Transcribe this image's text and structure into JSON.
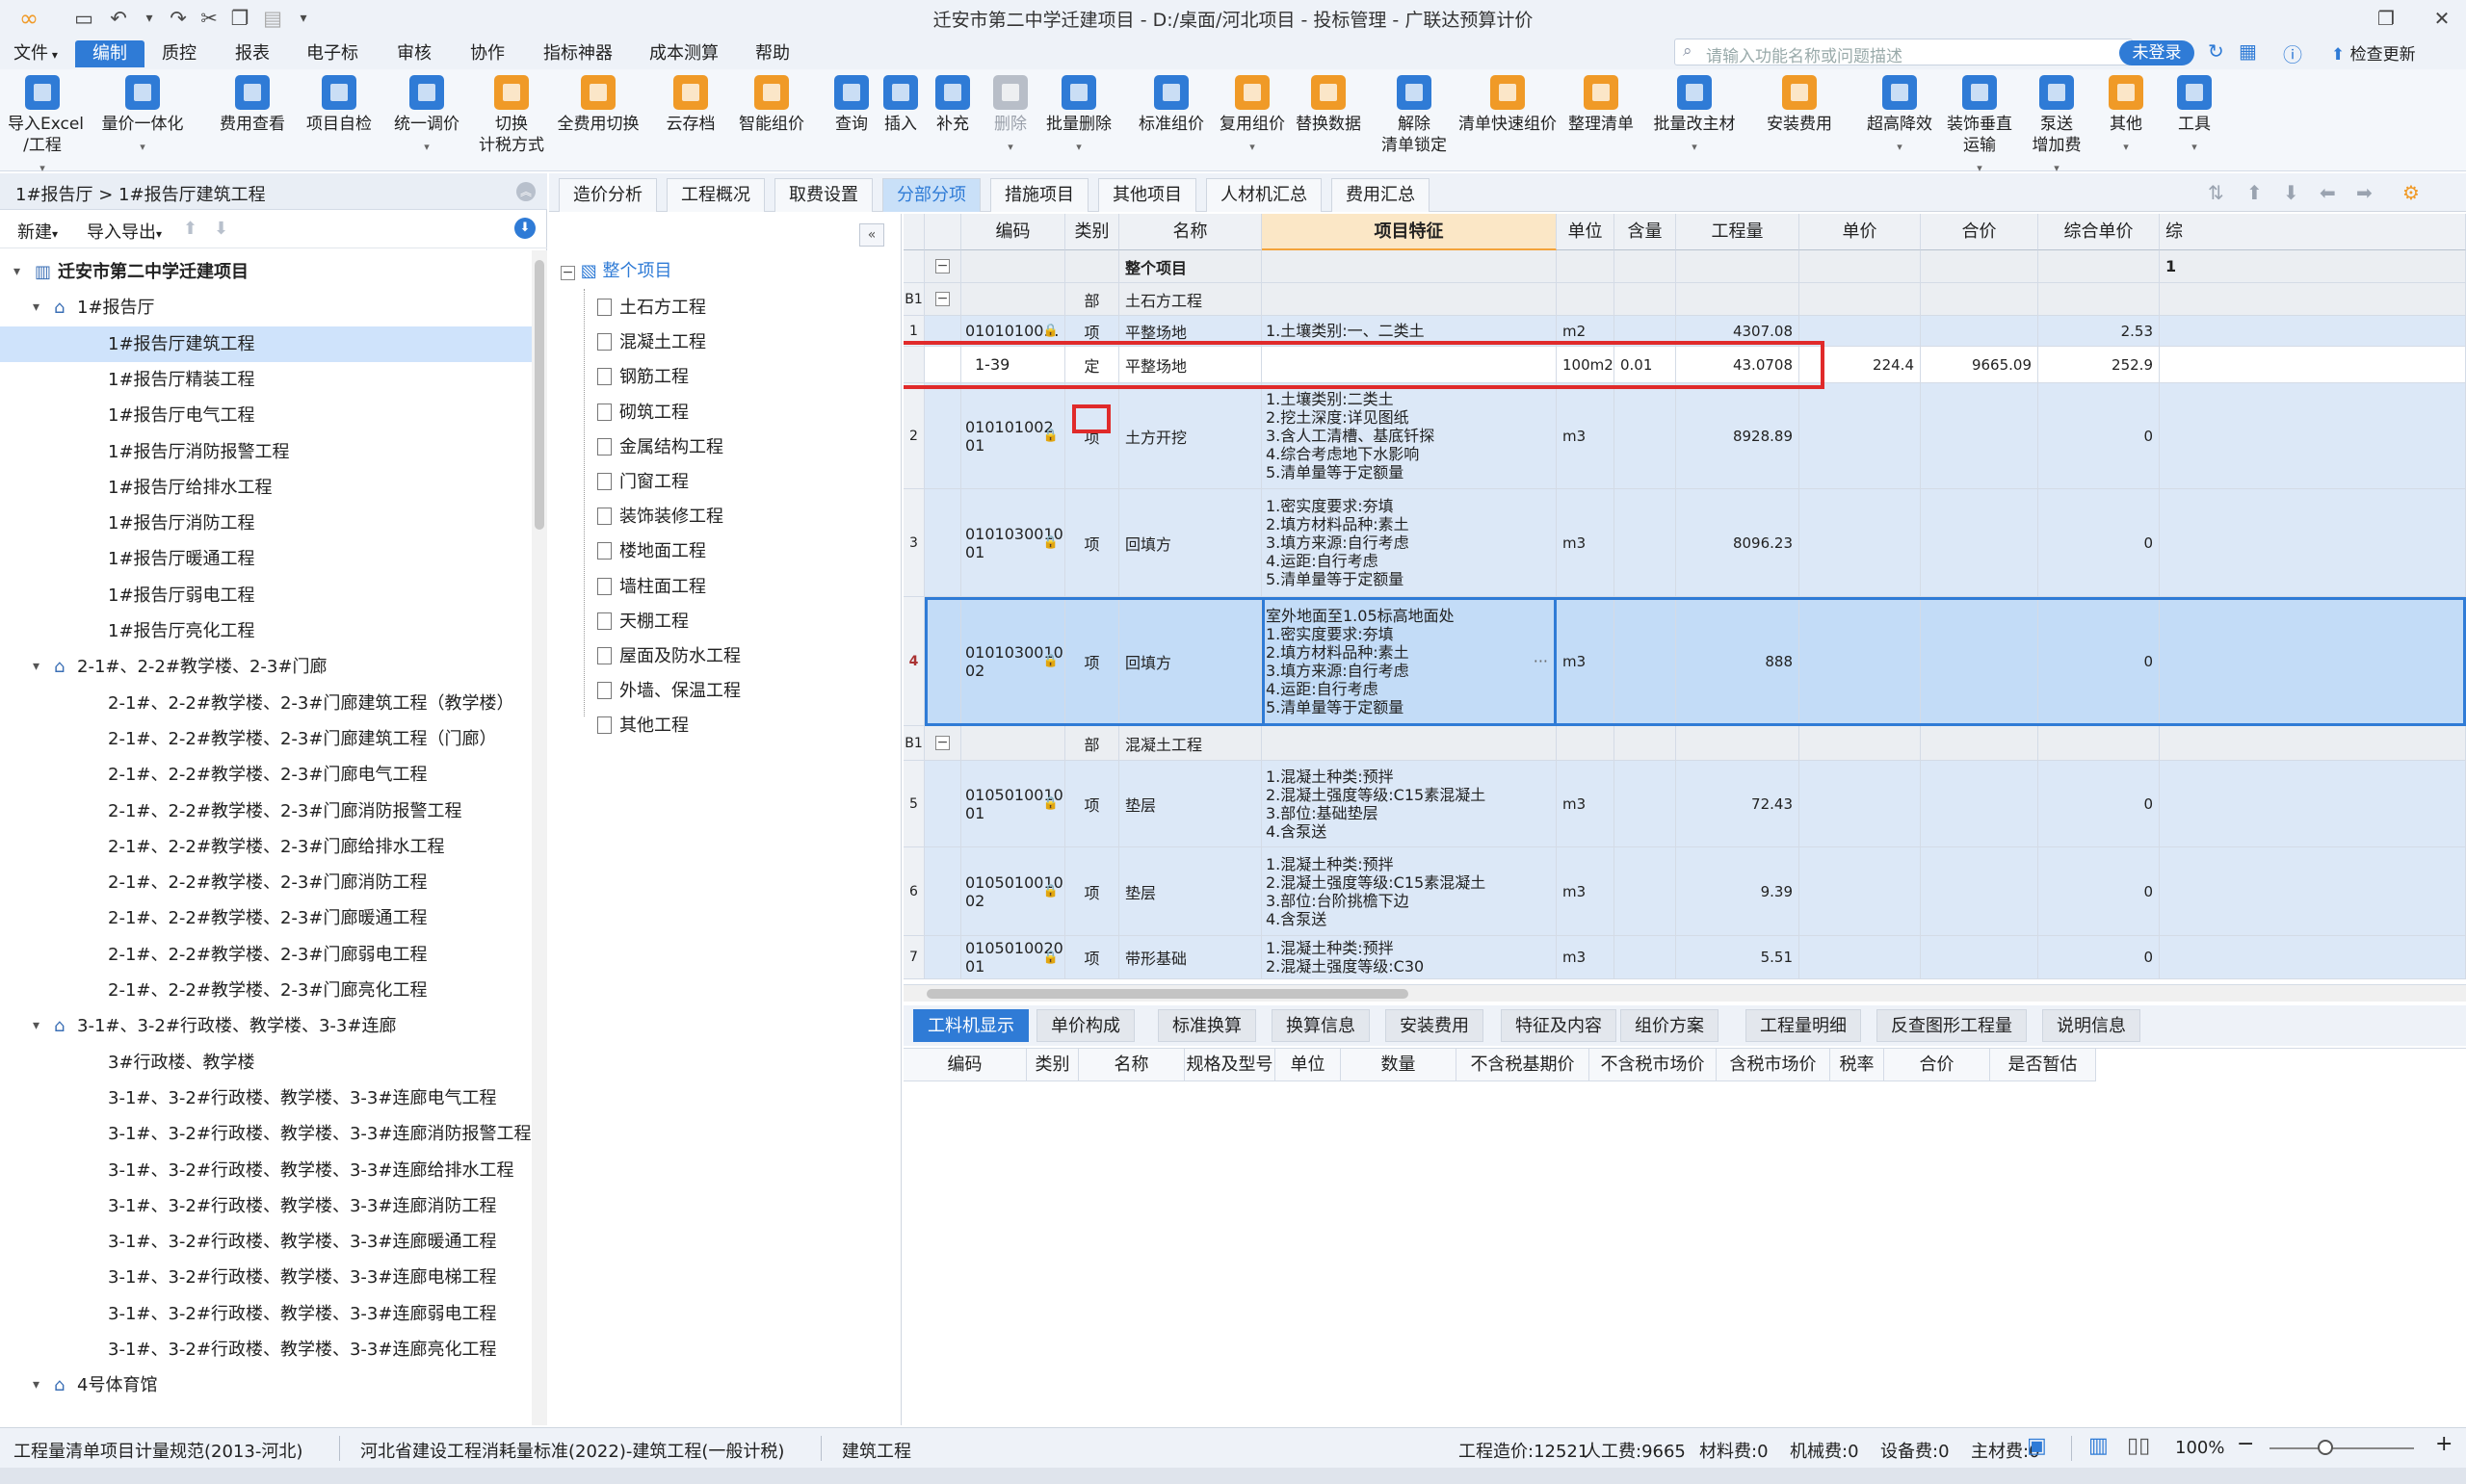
{
  "window": {
    "title": "迁安市第二中学迁建项目 - D:/桌面/河北项目 - 投标管理 - 广联达预算计价",
    "controls": {
      "restore": "❐",
      "close": "✕"
    }
  },
  "menus": [
    "文件",
    "编制",
    "质控",
    "报表",
    "电子标",
    "审核",
    "协作",
    "指标神器",
    "成本测算",
    "帮助"
  ],
  "active_menu": "编制",
  "search": {
    "placeholder": "请输入功能名称或问题描述"
  },
  "login_label": "未登录",
  "update_label": "检查更新",
  "ribbon": [
    {
      "label": "导入Excel\n/工程",
      "icon": "import-excel-icon",
      "color": "blue"
    },
    {
      "label": "量价一体化",
      "icon": "integration-icon",
      "color": "blue"
    },
    {
      "label": "费用查看",
      "icon": "fee-view-icon",
      "color": "blue"
    },
    {
      "label": "项目自检",
      "icon": "self-check-icon",
      "color": "blue"
    },
    {
      "label": "统一调价",
      "icon": "price-adjust-icon",
      "color": "blue"
    },
    {
      "label": "切换\n计税方式",
      "icon": "tax-switch-icon",
      "color": "orange"
    },
    {
      "label": "全费用切换",
      "icon": "full-cost-icon",
      "color": "orange"
    },
    {
      "label": "云存档",
      "icon": "cloud-save-icon",
      "color": "orange"
    },
    {
      "label": "智能组价",
      "icon": "smart-price-icon",
      "color": "orange"
    },
    {
      "label": "查询",
      "icon": "query-icon",
      "color": "blue"
    },
    {
      "label": "插入",
      "icon": "insert-icon",
      "color": "blue"
    },
    {
      "label": "补充",
      "icon": "supplement-icon",
      "color": "blue"
    },
    {
      "label": "删除",
      "icon": "delete-icon",
      "color": "gray"
    },
    {
      "label": "批量删除",
      "icon": "batch-delete-icon",
      "color": "blue"
    },
    {
      "label": "标准组价",
      "icon": "standard-price-icon",
      "color": "blue"
    },
    {
      "label": "复用组价",
      "icon": "reuse-price-icon",
      "color": "orange"
    },
    {
      "label": "替换数据",
      "icon": "replace-data-icon",
      "color": "orange"
    },
    {
      "label": "解除\n清单锁定",
      "icon": "unlock-icon",
      "color": "blue"
    },
    {
      "label": "清单快速组价",
      "icon": "quick-price-icon",
      "color": "orange"
    },
    {
      "label": "整理清单",
      "icon": "organize-icon",
      "color": "orange"
    },
    {
      "label": "批量改主材",
      "icon": "batch-material-icon",
      "color": "blue"
    },
    {
      "label": "安装费用",
      "icon": "install-fee-icon",
      "color": "orange"
    },
    {
      "label": "超高降效",
      "icon": "height-efficiency-icon",
      "color": "blue"
    },
    {
      "label": "装饰垂直\n运输",
      "icon": "vertical-transport-icon",
      "color": "blue"
    },
    {
      "label": "泵送\n增加费",
      "icon": "pump-fee-icon",
      "color": "blue"
    },
    {
      "label": "其他",
      "icon": "other-icon",
      "color": "orange"
    },
    {
      "label": "工具",
      "icon": "tools-icon",
      "color": "blue"
    }
  ],
  "left": {
    "breadcrumb": "1#报告厅 > 1#报告厅建筑工程",
    "new_label": "新建",
    "io_label": "导入导出",
    "tree": [
      {
        "label": "迁安市第二中学迁建项目",
        "level": 0,
        "type": "project",
        "expanded": true
      },
      {
        "label": "1#报告厅",
        "level": 1,
        "type": "unit",
        "expanded": true
      },
      {
        "label": "1#报告厅建筑工程",
        "level": 2,
        "selected": true
      },
      {
        "label": "1#报告厅精装工程",
        "level": 2
      },
      {
        "label": "1#报告厅电气工程",
        "level": 2
      },
      {
        "label": "1#报告厅消防报警工程",
        "level": 2
      },
      {
        "label": "1#报告厅给排水工程",
        "level": 2
      },
      {
        "label": "1#报告厅消防工程",
        "level": 2
      },
      {
        "label": "1#报告厅暖通工程",
        "level": 2
      },
      {
        "label": "1#报告厅弱电工程",
        "level": 2
      },
      {
        "label": "1#报告厅亮化工程",
        "level": 2
      },
      {
        "label": "2-1#、2-2#教学楼、2-3#门廊",
        "level": 1,
        "type": "unit",
        "expanded": true
      },
      {
        "label": "2-1#、2-2#教学楼、2-3#门廊建筑工程（教学楼）",
        "level": 2
      },
      {
        "label": "2-1#、2-2#教学楼、2-3#门廊建筑工程（门廊）",
        "level": 2
      },
      {
        "label": "2-1#、2-2#教学楼、2-3#门廊电气工程",
        "level": 2
      },
      {
        "label": "2-1#、2-2#教学楼、2-3#门廊消防报警工程",
        "level": 2
      },
      {
        "label": "2-1#、2-2#教学楼、2-3#门廊给排水工程",
        "level": 2
      },
      {
        "label": "2-1#、2-2#教学楼、2-3#门廊消防工程",
        "level": 2
      },
      {
        "label": "2-1#、2-2#教学楼、2-3#门廊暖通工程",
        "level": 2
      },
      {
        "label": "2-1#、2-2#教学楼、2-3#门廊弱电工程",
        "level": 2
      },
      {
        "label": "2-1#、2-2#教学楼、2-3#门廊亮化工程",
        "level": 2
      },
      {
        "label": "3-1#、3-2#行政楼、教学楼、3-3#连廊",
        "level": 1,
        "type": "unit",
        "expanded": true
      },
      {
        "label": "3#行政楼、教学楼",
        "level": 2
      },
      {
        "label": "3-1#、3-2#行政楼、教学楼、3-3#连廊电气工程",
        "level": 2
      },
      {
        "label": "3-1#、3-2#行政楼、教学楼、3-3#连廊消防报警工程",
        "level": 2
      },
      {
        "label": "3-1#、3-2#行政楼、教学楼、3-3#连廊给排水工程",
        "level": 2
      },
      {
        "label": "3-1#、3-2#行政楼、教学楼、3-3#连廊消防工程",
        "level": 2
      },
      {
        "label": "3-1#、3-2#行政楼、教学楼、3-3#连廊暖通工程",
        "level": 2
      },
      {
        "label": "3-1#、3-2#行政楼、教学楼、3-3#连廊电梯工程",
        "level": 2
      },
      {
        "label": "3-1#、3-2#行政楼、教学楼、3-3#连廊弱电工程",
        "level": 2
      },
      {
        "label": "3-1#、3-2#行政楼、教学楼、3-3#连廊亮化工程",
        "level": 2
      },
      {
        "label": "4号体育馆",
        "level": 1,
        "type": "unit",
        "expanded": true
      }
    ]
  },
  "mid_tree": {
    "root": "整个项目",
    "items": [
      "土石方工程",
      "混凝土工程",
      "钢筋工程",
      "砌筑工程",
      "金属结构工程",
      "门窗工程",
      "装饰装修工程",
      "楼地面工程",
      "墙柱面工程",
      "天棚工程",
      "屋面及防水工程",
      "外墙、保温工程",
      "其他工程"
    ]
  },
  "tabs": [
    "造价分析",
    "工程概况",
    "取费设置",
    "分部分项",
    "措施项目",
    "其他项目",
    "人材机汇总",
    "费用汇总"
  ],
  "active_tab": "分部分项",
  "grid": {
    "columns": [
      "编码",
      "类别",
      "名称",
      "项目特征",
      "单位",
      "含量",
      "工程量",
      "单价",
      "合价",
      "综合单价",
      "综"
    ],
    "active_column": "项目特征",
    "rows": [
      {
        "kind": "dept",
        "seq": "",
        "code": "",
        "type": "",
        "name": "整个项目",
        "feat": "",
        "unit": "",
        "qty_ratio": "",
        "qty": "",
        "price": "",
        "total": "",
        "unit_price": "",
        "extra": "1"
      },
      {
        "kind": "dept",
        "seq": "B1",
        "code": "",
        "type": "部",
        "name": "土石方工程",
        "feat": "",
        "unit": "",
        "qty_ratio": "",
        "qty": "",
        "price": "",
        "total": "",
        "unit_price": "",
        "extra": ""
      },
      {
        "kind": "item",
        "seq": "1",
        "code": "01010100…",
        "type": "项",
        "name": "平整场地",
        "feat": "1.土壤类别:一、二类土",
        "unit": "m2",
        "qty_ratio": "",
        "qty": "4307.08",
        "price": "",
        "total": "",
        "unit_price": "2.53",
        "extra": ""
      },
      {
        "kind": "white",
        "seq": "",
        "code": "1-39",
        "type": "定",
        "name": "平整场地",
        "feat": "",
        "unit": "100m2",
        "qty_ratio": "0.01",
        "qty": "43.0708",
        "price": "224.4",
        "total": "9665.09",
        "unit_price": "252.9",
        "extra": ""
      },
      {
        "kind": "item",
        "seq": "2",
        "code": "010101002\n01",
        "type": "项",
        "name": "土方开挖",
        "feat": "1.土壤类别:二类土\n2.挖土深度:详见图纸\n3.含人工清槽、基底钎探\n4.综合考虑地下水影响\n5.清单量等于定额量",
        "unit": "m3",
        "qty_ratio": "",
        "qty": "8928.89",
        "price": "",
        "total": "",
        "unit_price": "0",
        "extra": ""
      },
      {
        "kind": "item",
        "seq": "3",
        "code": "0101030010\n01",
        "type": "项",
        "name": "回填方",
        "feat": "1.密实度要求:夯填\n2.填方材料品种:素土\n3.填方来源:自行考虑\n4.运距:自行考虑\n5.清单量等于定额量",
        "unit": "m3",
        "qty_ratio": "",
        "qty": "8096.23",
        "price": "",
        "total": "",
        "unit_price": "0",
        "extra": ""
      },
      {
        "kind": "sel",
        "seq": "4",
        "code": "0101030010\n02",
        "type": "项",
        "name": "回填方",
        "feat": "室外地面至1.05标高地面处\n1.密实度要求:夯填\n2.填方材料品种:素土\n3.填方来源:自行考虑\n4.运距:自行考虑\n5.清单量等于定额量",
        "unit": "m3",
        "qty_ratio": "",
        "qty": "888",
        "price": "",
        "total": "",
        "unit_price": "0",
        "extra": ""
      },
      {
        "kind": "dept",
        "seq": "B1",
        "code": "",
        "type": "部",
        "name": "混凝土工程",
        "feat": "",
        "unit": "",
        "qty_ratio": "",
        "qty": "",
        "price": "",
        "total": "",
        "unit_price": "",
        "extra": ""
      },
      {
        "kind": "item",
        "seq": "5",
        "code": "0105010010\n01",
        "type": "项",
        "name": "垫层",
        "feat": "1.混凝土种类:预拌\n2.混凝土强度等级:C15素混凝土\n3.部位:基础垫层\n4.含泵送",
        "unit": "m3",
        "qty_ratio": "",
        "qty": "72.43",
        "price": "",
        "total": "",
        "unit_price": "0",
        "extra": ""
      },
      {
        "kind": "item",
        "seq": "6",
        "code": "0105010010\n02",
        "type": "项",
        "name": "垫层",
        "feat": "1.混凝土种类:预拌\n2.混凝土强度等级:C15素混凝土\n3.部位:台阶挑檐下边\n4.含泵送",
        "unit": "m3",
        "qty_ratio": "",
        "qty": "9.39",
        "price": "",
        "total": "",
        "unit_price": "0",
        "extra": ""
      },
      {
        "kind": "item",
        "seq": "7",
        "code": "0105010020\n01",
        "type": "项",
        "name": "带形基础",
        "feat": "1.混凝土种类:预拌\n2.混凝土强度等级:C30",
        "unit": "m3",
        "qty_ratio": "",
        "qty": "5.51",
        "price": "",
        "total": "",
        "unit_price": "0",
        "extra": ""
      }
    ]
  },
  "bottom_tabs": [
    "工料机显示",
    "单价构成",
    "标准换算",
    "换算信息",
    "安装费用",
    "特征及内容",
    "组价方案",
    "工程量明细",
    "反查图形工程量",
    "说明信息"
  ],
  "active_bottom_tab": "工料机显示",
  "bottom_grid_columns": [
    "编码",
    "类别",
    "名称",
    "规格及型号",
    "单位",
    "数量",
    "不含税基期价",
    "不含税市场价",
    "含税市场价",
    "税率",
    "合价",
    "是否暂估"
  ],
  "status": {
    "spec": "工程量清单项目计量规范(2013-河北)",
    "quota": "河北省建设工程消耗量标准(2022)-建筑工程(一般计税)",
    "discipline": "建筑工程",
    "cost": "工程造价:12521",
    "labor": "人工费:9665",
    "material": "材料费:0",
    "machine": "机械费:0",
    "equipment": "设备费:0",
    "main_material": "主材费:0",
    "zoom": "100%",
    "zoom_level": 1.0
  },
  "colors": {
    "accent": "#2f7bd6",
    "highlight": "#e02a2a",
    "selected_row": "#c3dcf7"
  }
}
